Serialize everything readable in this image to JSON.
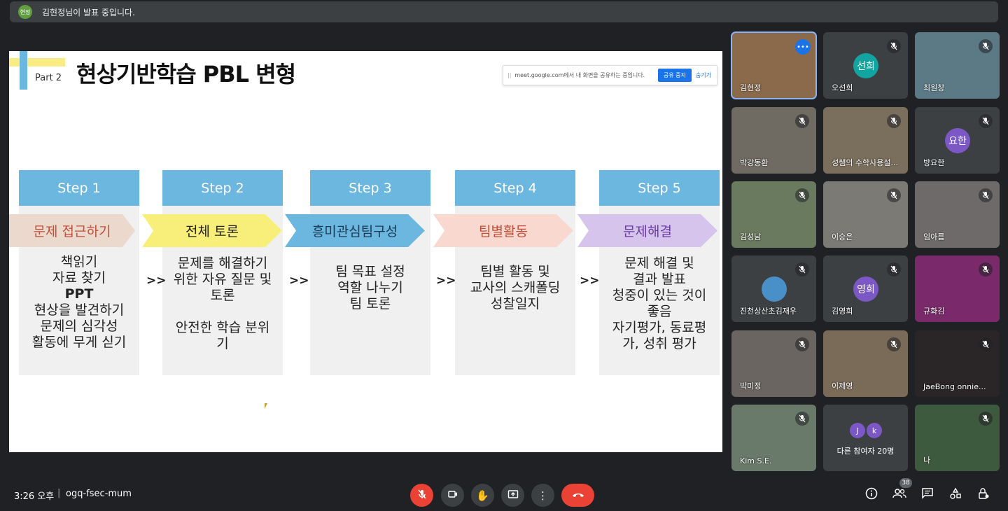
{
  "topbar": {
    "presenter_initials": "현정",
    "presenting_text": "김현정님이 발표 중입니다."
  },
  "slide": {
    "part_label": "Part 2",
    "title": "현상기반학습 PBL 변형",
    "share_bar": {
      "grip": "||",
      "text": "meet.google.com에서 내 화면을 공유하는 중입니다.",
      "stop_label": "공유 중지",
      "hide_label": "숨기기"
    },
    "steps": [
      {
        "header": "Step 1",
        "arrow": "문제 접근하기",
        "arrow_color": "#ead9cc",
        "arrow_text_color": "#c0503a",
        "body": [
          "책읽기",
          "자료 찾기",
          "PPT",
          "현상을 발견하기",
          "문제의 심각성",
          "활동에 무게 싣기"
        ]
      },
      {
        "header": "Step 2",
        "arrow": "전체 토론",
        "arrow_color": "#f8ef7a",
        "arrow_text_color": "#222222",
        "body": [
          "문제를 해결하기",
          "위한 자유 질문 및",
          "토론",
          "",
          "안전한 학습 분위",
          "기"
        ]
      },
      {
        "header": "Step 3",
        "arrow": "흥미관심팀구성",
        "arrow_color": "#6cb7e0",
        "arrow_text_color": "#1a3b55",
        "body": [
          "팀 목표 설정",
          "역할 나누기",
          "팀 토론"
        ]
      },
      {
        "header": "Step 4",
        "arrow": "팀별활동",
        "arrow_color": "#f8d8cf",
        "arrow_text_color": "#c0503a",
        "body": [
          "팀별 활동 및",
          "교사의 스캐폴딩",
          "성찰일지"
        ]
      },
      {
        "header": "Step 5",
        "arrow": "문제해결",
        "arrow_color": "#d7c4ec",
        "arrow_text_color": "#6a3aa0",
        "body": [
          "문제 해결 및",
          "결과 발표",
          "청중이 있는 것이",
          "좋음",
          "자기평가, 동료평",
          "가, 성취 평가"
        ]
      }
    ],
    "separator": ">>"
  },
  "participants": [
    {
      "name": "김현정",
      "type": "video",
      "speaking": true,
      "bg": "#8a6a4a"
    },
    {
      "name": "오선희",
      "type": "avatar",
      "initials": "선희",
      "avatar_color": "#12a4a0"
    },
    {
      "name": "최원창",
      "type": "video",
      "bg": "#5b7a86"
    },
    {
      "name": "박강동환",
      "type": "video",
      "bg": "#6f6a62"
    },
    {
      "name": "성쌤의 수학사용설...",
      "type": "video",
      "bg": "#7a6e5c"
    },
    {
      "name": "방요한",
      "type": "avatar",
      "initials": "요한",
      "avatar_color": "#7b58c6"
    },
    {
      "name": "김성남",
      "type": "video",
      "bg": "#6a7a5e"
    },
    {
      "name": "이승은",
      "type": "video",
      "bg": "#7c7a74"
    },
    {
      "name": "임아름",
      "type": "video",
      "bg": "#6e6a6a"
    },
    {
      "name": "진천상산초김재우",
      "type": "avatar",
      "initials": "",
      "avatar_color": "#4a90c8"
    },
    {
      "name": "김영희",
      "type": "avatar",
      "initials": "영희",
      "avatar_color": "#7b58c6"
    },
    {
      "name": "규화김",
      "type": "video",
      "bg": "#7a2a6a"
    },
    {
      "name": "박미정",
      "type": "video",
      "bg": "#6a6560"
    },
    {
      "name": "이제영",
      "type": "video",
      "bg": "#7a6a58"
    },
    {
      "name": "JaeBong onnie...",
      "type": "blank",
      "bg": "#2a2628"
    },
    {
      "name": "Kim S.E.",
      "type": "video",
      "bg": "#6a7a6a"
    },
    {
      "name": "다른 참여자 20명",
      "type": "others",
      "initials": [
        "J",
        "k"
      ]
    },
    {
      "name": "나",
      "type": "video",
      "bg": "#3e5a3e"
    }
  ],
  "bottombar": {
    "time": "3:26 오후",
    "separator": "|",
    "meeting_code": "ogq-fsec-mum",
    "participant_count": "38",
    "controls": [
      "mic-off-icon",
      "camera-icon",
      "raise-hand-icon",
      "present-icon",
      "more-icon",
      "end-call-icon"
    ],
    "right_controls": [
      "info-icon",
      "people-icon",
      "chat-icon",
      "activities-icon",
      "host-controls-icon"
    ]
  }
}
